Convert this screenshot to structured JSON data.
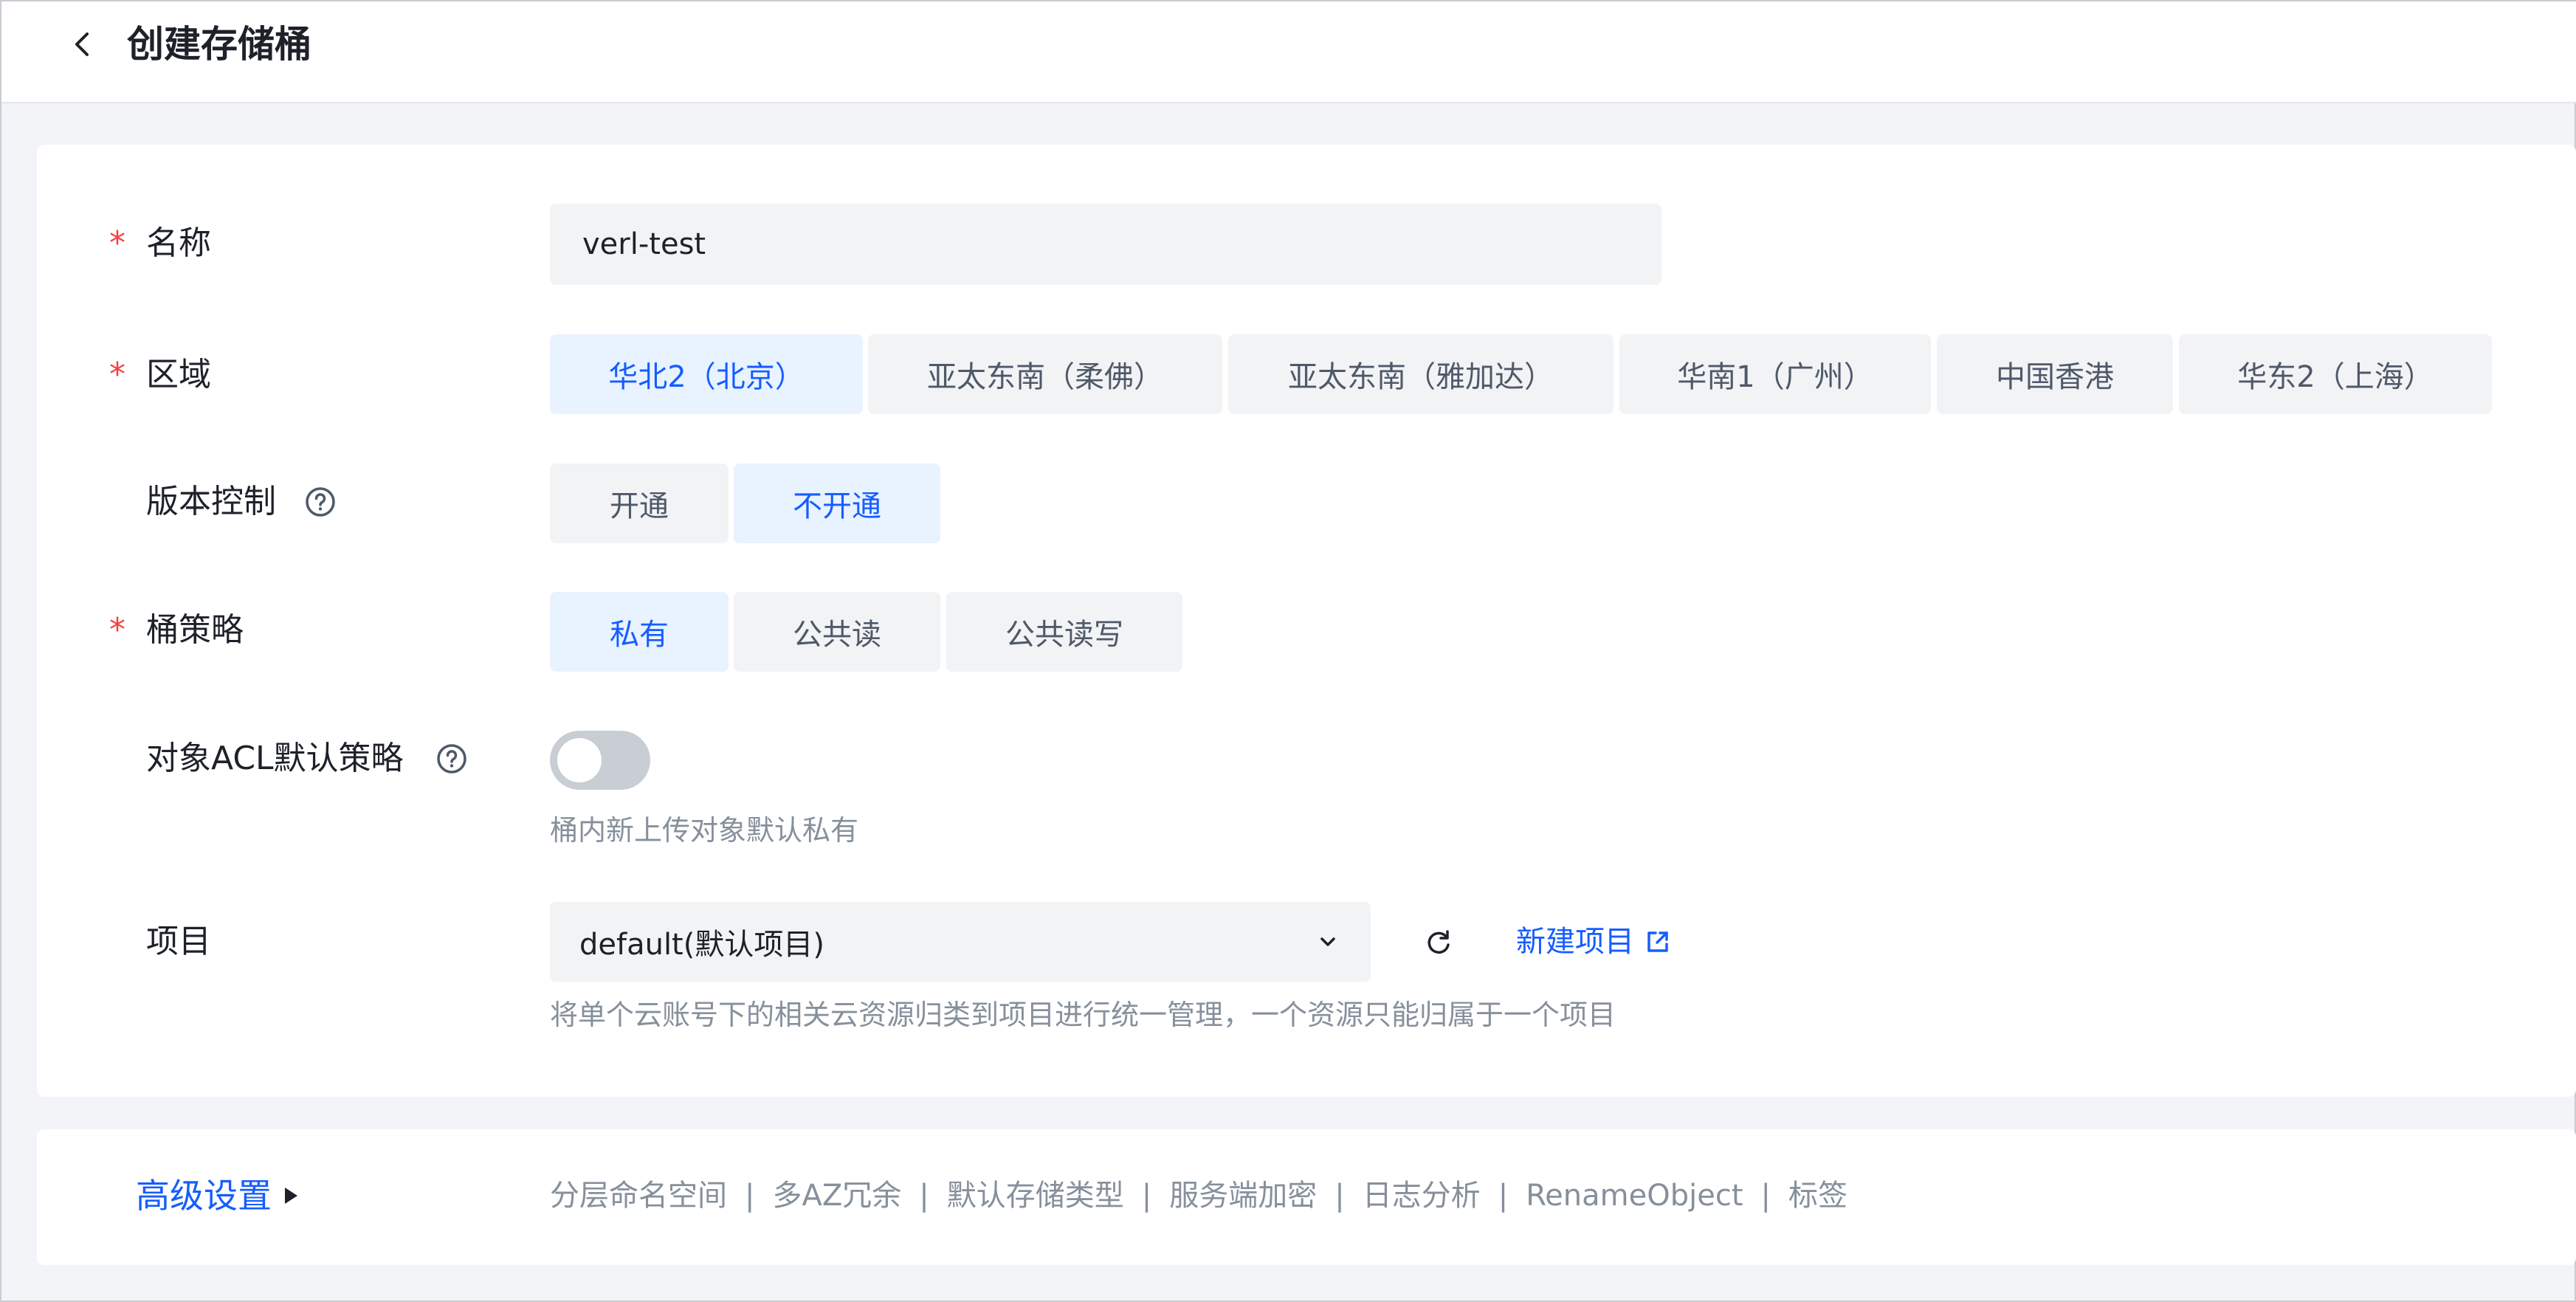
{
  "header": {
    "title": "创建存储桶"
  },
  "form": {
    "name": {
      "label": "名称",
      "required_mark": "*",
      "value": "verl-test"
    },
    "region": {
      "label": "区域",
      "required_mark": "*",
      "options": [
        "华北2（北京）",
        "亚太东南（柔佛）",
        "亚太东南（雅加达）",
        "华南1（广州）",
        "中国香港",
        "华东2（上海）"
      ],
      "selected": "华北2（北京）"
    },
    "versioning": {
      "label": "版本控制",
      "options": [
        "开通",
        "不开通"
      ],
      "selected": "不开通"
    },
    "bucket_policy": {
      "label": "桶策略",
      "required_mark": "*",
      "options": [
        "私有",
        "公共读",
        "公共读写"
      ],
      "selected": "私有"
    },
    "object_acl": {
      "label": "对象ACL默认策略",
      "enabled": false,
      "hint": "桶内新上传对象默认私有"
    },
    "project": {
      "label": "项目",
      "value": "default(默认项目)",
      "new_project_label": "新建项目",
      "hint": "将单个云账号下的相关云资源归类到项目进行统一管理，一个资源只能归属于一个项目"
    }
  },
  "advanced": {
    "label": "高级设置",
    "items": [
      "分层命名空间",
      "多AZ冗余",
      "默认存储类型",
      "服务端加密",
      "日志分析",
      "RenameObject",
      "标签"
    ],
    "separator": "|"
  },
  "colors": {
    "accent": "#165dff",
    "required": "#f53f3f",
    "active_bg": "#e8f3ff",
    "field_bg": "#f2f3f5"
  }
}
